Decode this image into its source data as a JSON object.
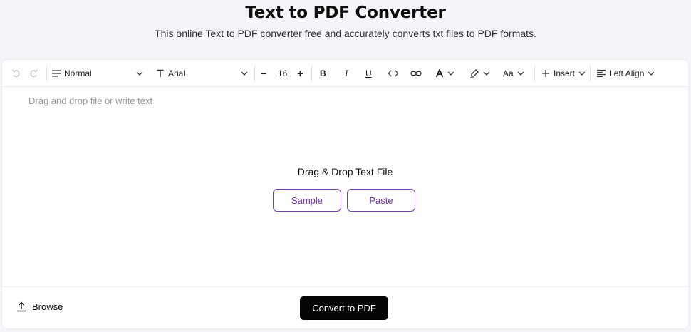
{
  "header": {
    "title": "Text to PDF Converter",
    "subtitle": "This online Text to PDF converter free and accurately converts txt files to PDF formats."
  },
  "toolbar": {
    "paragraph_style": "Normal",
    "font_family": "Arial",
    "font_size": "16",
    "decrease_label": "−",
    "increase_label": "+",
    "bold_label": "B",
    "italic_label": "I",
    "underline_label": "U",
    "text_case_label": "Aa",
    "insert_label": "Insert",
    "align_label": "Left Align"
  },
  "editor": {
    "placeholder": "Drag and drop file or write text",
    "drop_title": "Drag & Drop Text File",
    "sample_label": "Sample",
    "paste_label": "Paste"
  },
  "footer": {
    "browse_label": "Browse",
    "convert_label": "Convert to PDF"
  },
  "colors": {
    "accent": "#7b3fb8",
    "convert_bg": "#050505",
    "background": "#f4f5f9"
  }
}
